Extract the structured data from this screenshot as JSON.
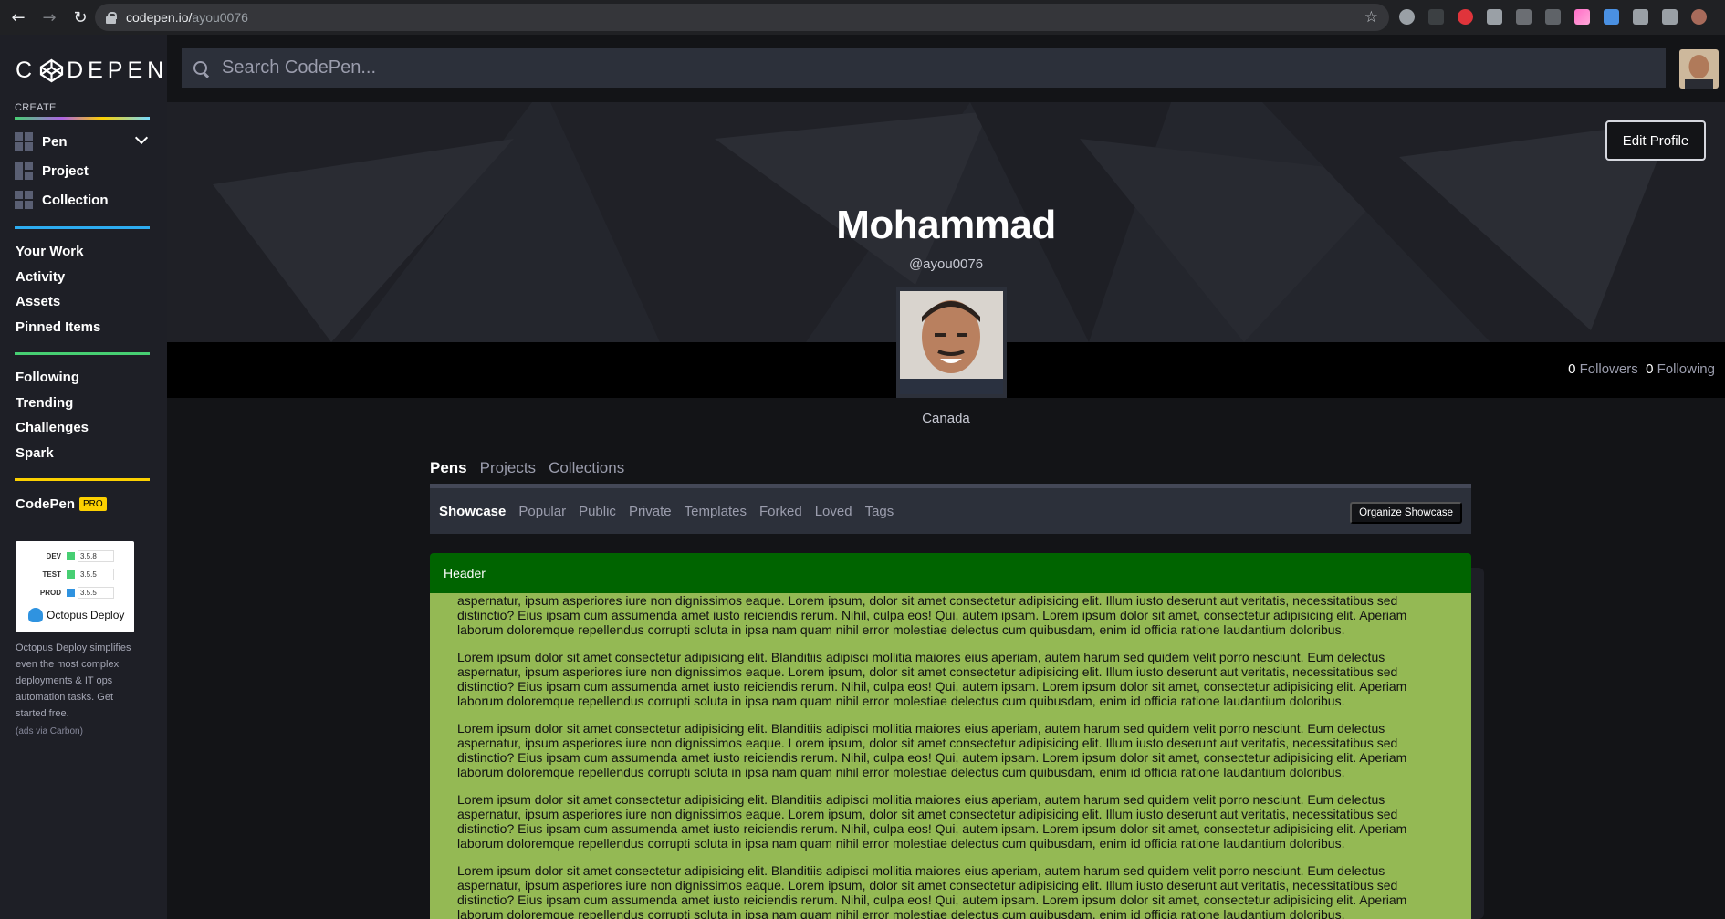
{
  "browser": {
    "url_domain": "codepen.io/",
    "url_path": "ayou0076"
  },
  "sidebar": {
    "logo": "CODEPEN",
    "create_label": "CREATE",
    "create_items": [
      {
        "label": "Pen",
        "icon": "pen-grid-icon"
      },
      {
        "label": "Project",
        "icon": "project-grid-icon"
      },
      {
        "label": "Collection",
        "icon": "collection-grid-icon"
      }
    ],
    "nav_primary": [
      "Your Work",
      "Activity",
      "Assets",
      "Pinned Items"
    ],
    "nav_secondary": [
      "Following",
      "Trending",
      "Challenges",
      "Spark"
    ],
    "pro": {
      "label": "CodePen",
      "badge": "PRO"
    },
    "ad": {
      "rows": [
        {
          "label": "DEV",
          "value": "3.5.8"
        },
        {
          "label": "TEST",
          "value": "3.5.5"
        },
        {
          "label": "PROD",
          "value": "3.5.5"
        }
      ],
      "brand": "Octopus Deploy",
      "text": "Octopus Deploy simplifies even the most complex deployments & IT ops automation tasks. Get started free.",
      "via": "(ads via Carbon)"
    }
  },
  "search": {
    "placeholder": "Search CodePen..."
  },
  "profile": {
    "name": "Mohammad",
    "handle": "@ayou0076",
    "location": "Canada",
    "edit_label": "Edit Profile",
    "followers_count": "0",
    "followers_label": "Followers",
    "following_count": "0",
    "following_label": "Following"
  },
  "tabs": [
    "Pens",
    "Projects",
    "Collections"
  ],
  "subtabs": [
    "Showcase",
    "Popular",
    "Public",
    "Private",
    "Templates",
    "Forked",
    "Loved",
    "Tags"
  ],
  "organize_label": "Organize Showcase",
  "card": {
    "header": "Header",
    "paragraphs": [
      "Lorem ipsum dolor sit amet consectetur adipisicing elit. Blanditiis adipisci mollitia maiores eius aperiam, autem harum sed quidem velit porro nesciunt. Eum delectus aspernatur, ipsum asperiores iure non dignissimos eaque. Lorem ipsum, dolor sit amet consectetur adipisicing elit. Illum iusto deserunt aut veritatis, necessitatibus sed distinctio? Eius ipsam cum assumenda amet iusto reiciendis rerum. Nihil, culpa eos! Qui, autem ipsam. Lorem ipsum dolor sit amet, consectetur adipisicing elit. Aperiam laborum doloremque repellendus corrupti soluta in ipsa nam quam nihil error molestiae delectus cum quibusdam, enim id officia ratione laudantium doloribus.",
      "Lorem ipsum dolor sit amet consectetur adipisicing elit. Blanditiis adipisci mollitia maiores eius aperiam, autem harum sed quidem velit porro nesciunt. Eum delectus aspernatur, ipsum asperiores iure non dignissimos eaque. Lorem ipsum, dolor sit amet consectetur adipisicing elit. Illum iusto deserunt aut veritatis, necessitatibus sed distinctio? Eius ipsam cum assumenda amet iusto reiciendis rerum. Nihil, culpa eos! Qui, autem ipsam. Lorem ipsum dolor sit amet, consectetur adipisicing elit. Aperiam laborum doloremque repellendus corrupti soluta in ipsa nam quam nihil error molestiae delectus cum quibusdam, enim id officia ratione laudantium doloribus.",
      "Lorem ipsum dolor sit amet consectetur adipisicing elit. Blanditiis adipisci mollitia maiores eius aperiam, autem harum sed quidem velit porro nesciunt. Eum delectus aspernatur, ipsum asperiores iure non dignissimos eaque. Lorem ipsum, dolor sit amet consectetur adipisicing elit. Illum iusto deserunt aut veritatis, necessitatibus sed distinctio? Eius ipsam cum assumenda amet iusto reiciendis rerum. Nihil, culpa eos! Qui, autem ipsam. Lorem ipsum dolor sit amet, consectetur adipisicing elit. Aperiam laborum doloremque repellendus corrupti soluta in ipsa nam quam nihil error molestiae delectus cum quibusdam, enim id officia ratione laudantium doloribus.",
      "Lorem ipsum dolor sit amet consectetur adipisicing elit. Blanditiis adipisci mollitia maiores eius aperiam, autem harum sed quidem velit porro nesciunt. Eum delectus aspernatur, ipsum asperiores iure non dignissimos eaque. Lorem ipsum, dolor sit amet consectetur adipisicing elit. Illum iusto deserunt aut veritatis, necessitatibus sed distinctio? Eius ipsam cum assumenda amet iusto reiciendis rerum. Nihil, culpa eos! Qui, autem ipsam. Lorem ipsum dolor sit amet, consectetur adipisicing elit. Aperiam laborum doloremque repellendus corrupti soluta in ipsa nam quam nihil error molestiae delectus cum quibusdam, enim id officia ratione laudantium doloribus.",
      "Lorem ipsum dolor sit amet consectetur adipisicing elit. Blanditiis adipisci mollitia maiores eius aperiam, autem harum sed quidem velit porro nesciunt. Eum delectus aspernatur, ipsum asperiores iure non dignissimos eaque. Lorem ipsum, dolor sit amet consectetur adipisicing elit. Illum iusto deserunt aut veritatis, necessitatibus sed distinctio? Eius ipsam cum assumenda amet iusto reiciendis rerum. Nihil, culpa eos! Qui, autem ipsam. Lorem ipsum dolor sit amet, consectetur adipisicing elit. Aperiam laborum doloremque repellendus corrupti soluta in ipsa nam quam nihil error molestiae delectus cum quibusdam, enim id officia ratione laudantium doloribus."
    ]
  },
  "colors": {
    "sidebar_bg": "#1e1f26",
    "card_header": "#006400",
    "card_body": "#94b954",
    "divider_blue": "#2dacf0",
    "divider_green": "#47cf73",
    "divider_yellow": "#fcd000"
  }
}
